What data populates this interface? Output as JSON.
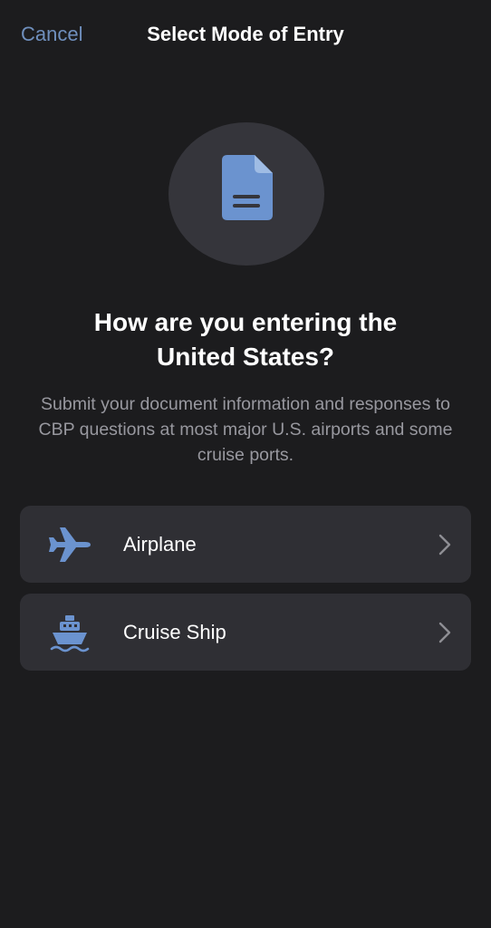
{
  "nav": {
    "cancel_label": "Cancel",
    "title": "Select Mode of Entry"
  },
  "hero": {
    "icon": "document-icon",
    "accent_color": "#6b93cf",
    "circle_color": "#35353b"
  },
  "headline": {
    "line1": "How are you entering the",
    "line2": "United States?"
  },
  "subtext": {
    "line1": "Submit your document information and responses to",
    "line2": "CBP questions at most major U.S. airports and some",
    "line3": "cruise ports."
  },
  "options": [
    {
      "label": "Airplane",
      "icon": "airplane-icon"
    },
    {
      "label": "Cruise Ship",
      "icon": "cruise-ship-icon"
    }
  ],
  "colors": {
    "background": "#1c1c1e",
    "card": "#2f2f34",
    "link": "#6f8fbd",
    "secondary_text": "#98989f"
  }
}
